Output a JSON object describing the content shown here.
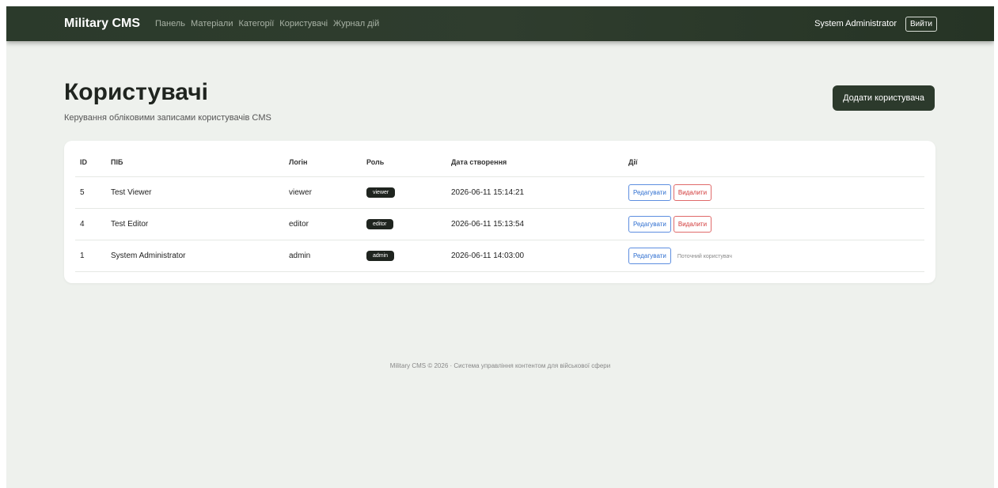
{
  "nav": {
    "brand": "Military CMS",
    "links": [
      "Панель",
      "Матеріали",
      "Категорії",
      "Користувачі",
      "Журнал дій"
    ],
    "user_name": "System Administrator",
    "logout_label": "Вийти"
  },
  "page": {
    "title": "Користувачі",
    "subtitle": "Керування обліковими записами користувачів CMS",
    "add_button": "Додати користувача"
  },
  "table": {
    "headers": [
      "ID",
      "ПІБ",
      "Логін",
      "Роль",
      "Дата створення",
      "Дії"
    ],
    "rows": [
      {
        "id": "5",
        "name": "Test Viewer",
        "login": "viewer",
        "role": "viewer",
        "created": "2026-06-11 15:14:21",
        "edit": "Редагувати",
        "delete": "Видалити",
        "note": ""
      },
      {
        "id": "4",
        "name": "Test Editor",
        "login": "editor",
        "role": "editor",
        "created": "2026-06-11 15:13:54",
        "edit": "Редагувати",
        "delete": "Видалити",
        "note": ""
      },
      {
        "id": "1",
        "name": "System Administrator",
        "login": "admin",
        "role": "admin",
        "created": "2026-06-11 14:03:00",
        "edit": "Редагувати",
        "delete": "",
        "note": "Поточний користувач"
      }
    ]
  },
  "footer": {
    "text": "Military CMS © 2026 · Система управління контентом для військової сфери"
  },
  "colors": {
    "navbar": "#2b3a2b",
    "page_background": "#eef1ed",
    "primary_button": "#2c3a2c",
    "edit_blue": "#2f6fd0",
    "delete_red": "#d23a3a"
  }
}
